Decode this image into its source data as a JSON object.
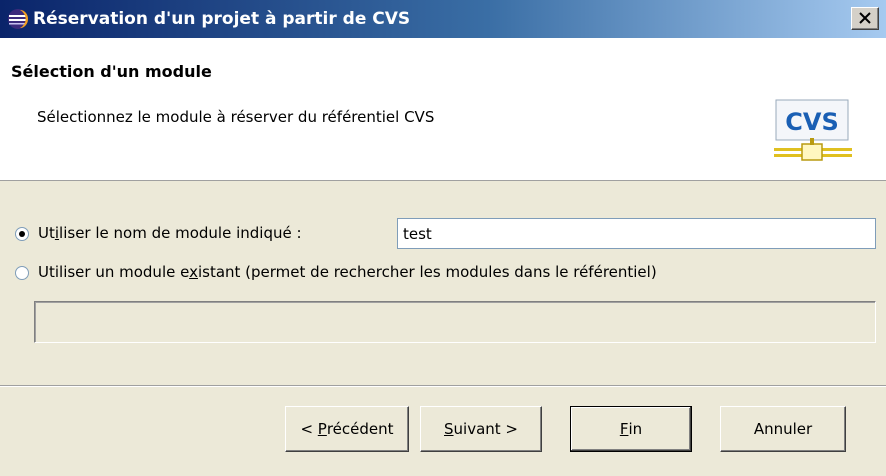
{
  "window": {
    "title": "Réservation d'un projet à partir de CVS",
    "close_icon": "close-x"
  },
  "header": {
    "title": "Sélection d'un module",
    "description": "Sélectionnez le module à réserver du référentiel CVS",
    "logo_text": "CVS"
  },
  "options": {
    "use_named": {
      "pre": "Ut",
      "mnemonic": "i",
      "post": "liser le nom de module indiqué :",
      "selected": true
    },
    "module_name_value": "test",
    "use_existing": {
      "pre": "Utiliser un module e",
      "mnemonic": "x",
      "post": "istant (permet de rechercher les modules dans le référentiel)",
      "selected": false
    }
  },
  "buttons": {
    "back": {
      "pre": "< ",
      "mnemonic": "P",
      "post": "récédent"
    },
    "next": {
      "pre": "",
      "mnemonic": "S",
      "post": "uivant >"
    },
    "finish": {
      "pre": "",
      "mnemonic": "F",
      "post": "in"
    },
    "cancel": {
      "label": "Annuler"
    }
  },
  "colors": {
    "title_bar_start": "#0a246a",
    "title_bar_end": "#a6caf0",
    "dialog_bg": "#ece9d8",
    "cvs_blue": "#1a5fb4",
    "cvs_connector": "#e0c020"
  }
}
